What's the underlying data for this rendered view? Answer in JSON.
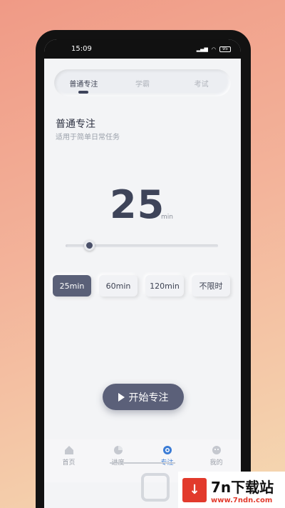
{
  "status": {
    "time": "15:09",
    "battery": "95"
  },
  "tabs": [
    {
      "label": "普通专注",
      "active": true
    },
    {
      "label": "学霸",
      "active": false
    },
    {
      "label": "考试",
      "active": false
    }
  ],
  "mode": {
    "title": "普通专注",
    "subtitle": "适用于简单日常任务"
  },
  "timer": {
    "value": "25",
    "unit": "min",
    "slider_fraction": 0.14
  },
  "chips": [
    "25min",
    "60min",
    "120min",
    "不限时"
  ],
  "start_button": "开始专注",
  "nav": [
    {
      "label": "首页",
      "icon": "home-icon"
    },
    {
      "label": "进度",
      "icon": "progress-icon"
    },
    {
      "label": "专注",
      "icon": "focus-icon",
      "active": true
    },
    {
      "label": "我的",
      "icon": "profile-icon"
    }
  ],
  "watermark": {
    "title": "7n下载站",
    "url": "www.7ndn.com"
  },
  "colors": {
    "accent": "#5b6079",
    "nav_active": "#3a7bd5",
    "watermark_red": "#e23a2c"
  }
}
